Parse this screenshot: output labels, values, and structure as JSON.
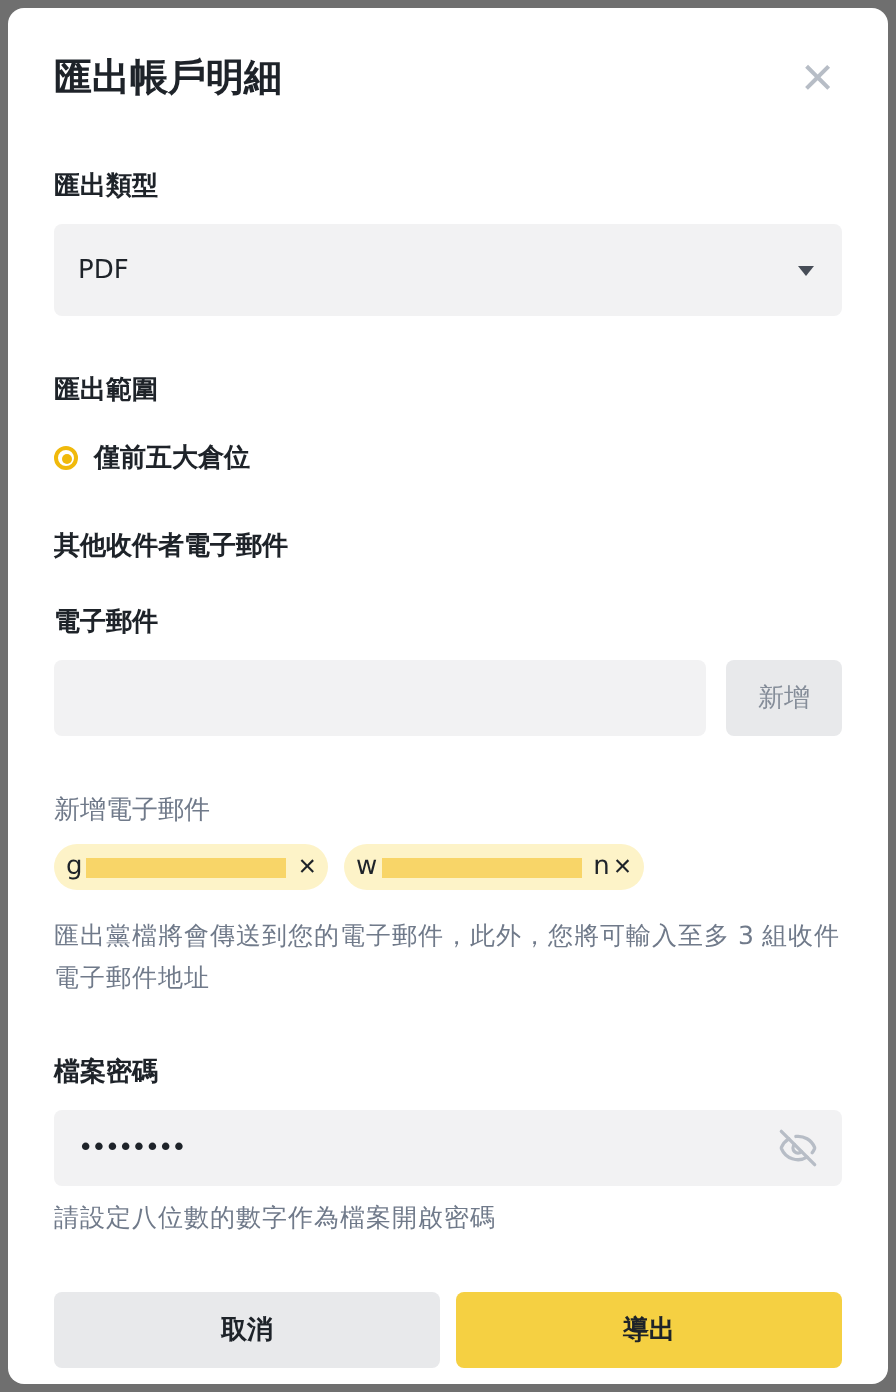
{
  "dialog": {
    "title": "匯出帳戶明細",
    "close": "×"
  },
  "export_type": {
    "label": "匯出類型",
    "value": "PDF"
  },
  "export_range": {
    "label": "匯出範圍",
    "options": [
      {
        "label": "僅前五大倉位",
        "selected": true
      }
    ]
  },
  "recipients": {
    "heading": "其他收件者電子郵件",
    "email_label": "電子郵件",
    "add_button": "新增",
    "added_label": "新增電子郵件",
    "chips": [
      {
        "visible_start": "g",
        "redacted": true,
        "remove": "×"
      },
      {
        "visible_start": "w",
        "visible_end": "n",
        "redacted": true,
        "remove": "×"
      }
    ],
    "helper": "匯出黨檔將會傳送到您的電子郵件，此外，您將可輸入至多 3 組收件電子郵件地址"
  },
  "password": {
    "label": "檔案密碼",
    "value": "••••••••",
    "hint": "請設定八位數的數字作為檔案開啟密碼"
  },
  "buttons": [
    {
      "label": "取消",
      "kind": "secondary"
    },
    {
      "label": "導出",
      "kind": "primary"
    }
  ]
}
